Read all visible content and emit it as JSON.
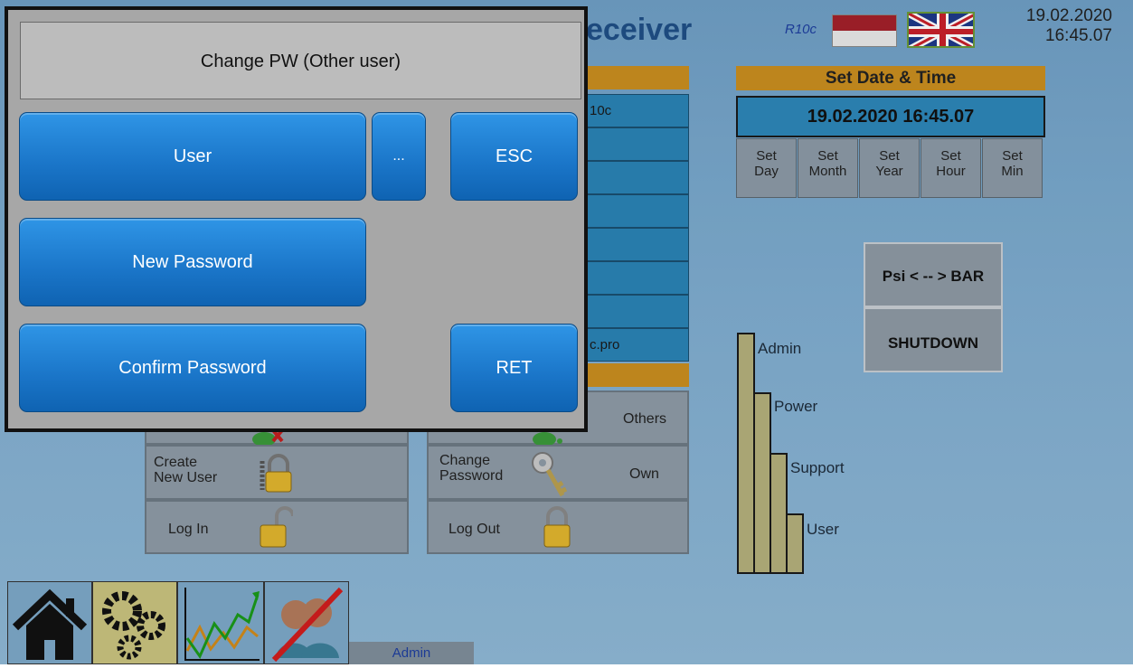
{
  "header": {
    "title_partial": "eceiver",
    "model": "R10c",
    "date": "19.02.2020",
    "time": "16:45.07"
  },
  "colors": {
    "accent_orange": "#c98e1f",
    "button_blue": "#1a75c8",
    "background_blue": "#7fadd0"
  },
  "middle_column": {
    "cell_1": "10c",
    "cell_8": "c.pro"
  },
  "set_datetime": {
    "title": "Set Date & Time",
    "display": "19.02.2020 16:45.07",
    "buttons": [
      {
        "line1": "Set",
        "line2": "Day"
      },
      {
        "line1": "Set",
        "line2": "Month"
      },
      {
        "line1": "Set",
        "line2": "Year"
      },
      {
        "line1": "Set",
        "line2": "Hour"
      },
      {
        "line1": "Set",
        "line2": "Min"
      }
    ]
  },
  "actions": {
    "psi_bar": "Psi < -- > BAR",
    "shutdown": "SHUTDOWN"
  },
  "user_levels": [
    {
      "label": "Admin",
      "level": 4
    },
    {
      "label": "Power",
      "level": 3
    },
    {
      "label": "Support",
      "level": 2
    },
    {
      "label": "User",
      "level": 1
    }
  ],
  "user_mgmt": {
    "others": "Others",
    "create_line1": "Create",
    "create_line2": "New User",
    "change_line1": "Change",
    "change_line2": "Password",
    "own": "Own",
    "login": "Log In",
    "logout": "Log Out"
  },
  "nav": {
    "current_user": "Admin",
    "icons": [
      "home-icon",
      "gears-icon",
      "trend-chart-icon",
      "users-disabled-icon"
    ]
  },
  "dialog": {
    "title": "Change PW (Other user)",
    "user": "User",
    "browse": "...",
    "esc": "ESC",
    "new_password": "New Password",
    "confirm_password": "Confirm Password",
    "ret": "RET"
  }
}
